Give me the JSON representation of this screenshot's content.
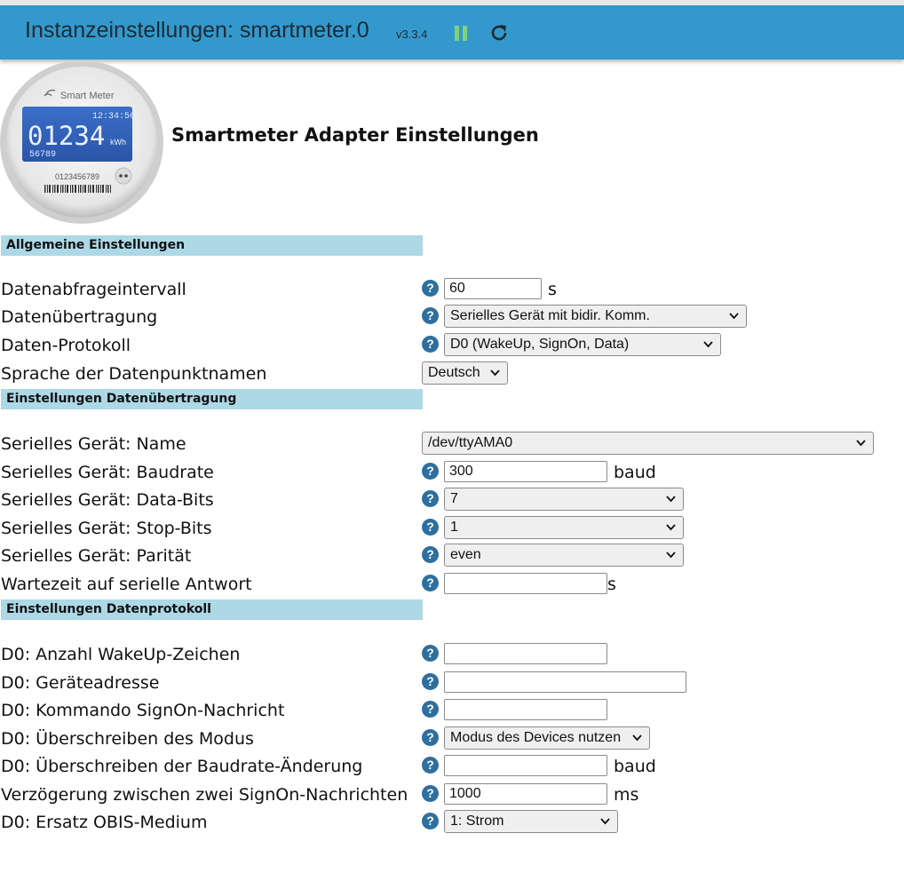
{
  "header": {
    "title": "Instanzeinstellungen: smartmeter.0",
    "version": "v3.3.4",
    "bg_color": "#3399cc",
    "pause_icon": "pause-icon",
    "reload_icon": "reload-icon"
  },
  "logo": {
    "brand": "Smart Meter",
    "time": "12:34:56",
    "reading": "01234",
    "unit": "kWh",
    "sub": "56789",
    "serial": "0123456789"
  },
  "page_title": "Smartmeter Adapter Einstellungen",
  "sections": {
    "general": "Allgemeine Einstellungen",
    "transfer": "Einstellungen Datenübertragung",
    "protocol": "Einstellungen Datenprotokoll"
  },
  "fields": {
    "interval": {
      "label": "Datenabfrageintervall",
      "value": "60",
      "unit": "s"
    },
    "transfer": {
      "label": "Datenübertragung",
      "value": "Serielles Gerät mit bidir. Komm."
    },
    "protocol": {
      "label": "Daten-Protokoll",
      "value": "D0 (WakeUp, SignOn, Data)"
    },
    "language": {
      "label": "Sprache der Datenpunktnamen",
      "value": "Deutsch"
    },
    "serial_name": {
      "label": "Serielles Gerät: Name",
      "value": "/dev/ttyAMA0"
    },
    "baudrate": {
      "label": "Serielles Gerät: Baudrate",
      "value": "300",
      "unit": "baud"
    },
    "databits": {
      "label": "Serielles Gerät: Data-Bits",
      "value": "7"
    },
    "stopbits": {
      "label": "Serielles Gerät: Stop-Bits",
      "value": "1"
    },
    "parity": {
      "label": "Serielles Gerät: Parität",
      "value": "even"
    },
    "wait": {
      "label": "Wartezeit auf serielle Antwort",
      "value": "",
      "unit": "s"
    },
    "wakeup_count": {
      "label": "D0: Anzahl WakeUp-Zeichen",
      "value": ""
    },
    "device_address": {
      "label": "D0: Geräteadresse",
      "value": ""
    },
    "signon_command": {
      "label": "D0: Kommando SignOn-Nachricht",
      "value": ""
    },
    "mode_override": {
      "label": "D0: Überschreiben des Modus",
      "value": "Modus des Devices nutzen"
    },
    "baud_override": {
      "label": "D0: Überschreiben der Baudrate-Änderung",
      "value": "",
      "unit": "baud"
    },
    "signon_delay": {
      "label": "Verzögerung zwischen zwei SignOn-Nachrichten",
      "value": "1000",
      "unit": "ms"
    },
    "obis_medium": {
      "label": "D0: Ersatz OBIS-Medium",
      "value": "1: Strom"
    }
  },
  "help_glyph": "?"
}
